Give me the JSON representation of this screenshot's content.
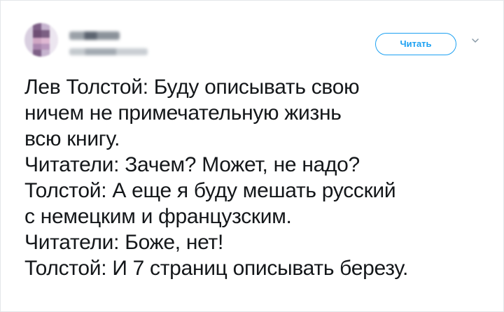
{
  "header": {
    "follow_label": "Читать",
    "avatar_icon": "avatar-blurred",
    "chevron_icon": "chevron-down-icon"
  },
  "tweet": {
    "lines": [
      "Лев Толстой: Буду описывать свою",
      "ничем не примечательную жизнь",
      "всю книгу.",
      "Читатели: Зачем? Может, не надо?",
      "Толстой: А еще я буду мешать русский",
      "с немецким и французским.",
      "Читатели: Боже, нет!",
      "Толстой: И 7 страниц описывать березу."
    ]
  },
  "colors": {
    "accent": "#1da1f2",
    "text": "#14171a",
    "border": "#e3e6e9"
  }
}
